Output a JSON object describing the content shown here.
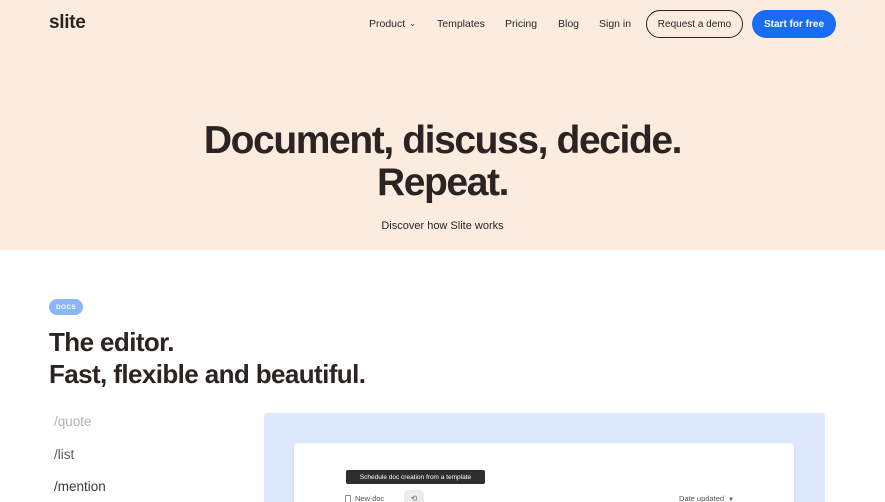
{
  "brand": {
    "logo": "slite",
    "accent": "#1a6cf5",
    "hero_bg": "#fcece0"
  },
  "nav": {
    "product": "Product",
    "templates": "Templates",
    "pricing": "Pricing",
    "blog": "Blog",
    "signin": "Sign in",
    "request_demo": "Request a demo",
    "start_free": "Start for free"
  },
  "hero": {
    "line1": "Document, discuss, decide.",
    "line2": "Repeat.",
    "subtitle": "Discover how Slite works"
  },
  "docs_section": {
    "badge": "DOCS",
    "title_line1": "The editor.",
    "title_line2": "Fast, flexible and beautiful.",
    "commands": [
      "/quote",
      "/list",
      "/mention"
    ]
  },
  "editor_preview": {
    "tooltip": "Schedule doc creation from a template",
    "new_doc": "New doc",
    "sort": "Date updated"
  }
}
